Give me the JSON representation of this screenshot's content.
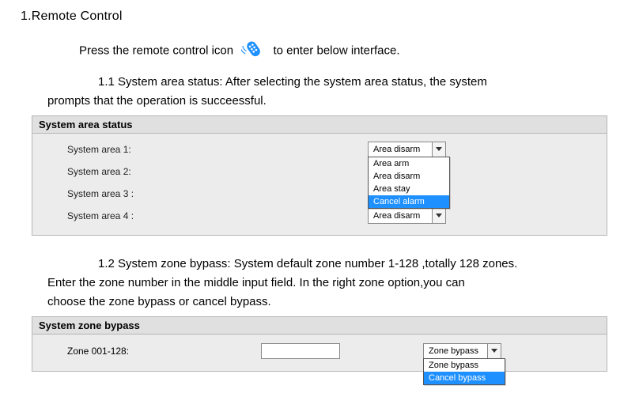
{
  "heading": "1.Remote Control",
  "intro_before": "Press the remote control icon",
  "intro_after": "to enter below interface.",
  "section11_lead": "1.1 System area status: After selecting the system area status, the system",
  "section11_cont": "prompts that the operation is succeessful.",
  "panel1": {
    "title": "System area status",
    "rows": [
      {
        "label": "System area 1:",
        "value": "Area disarm"
      },
      {
        "label": "System area 2:",
        "value": ""
      },
      {
        "label": "System area 3 :",
        "value": ""
      },
      {
        "label": "System area 4 :",
        "value": "Area disarm"
      }
    ],
    "dropdown_options": [
      "Area arm",
      "Area disarm",
      "Area stay",
      "Cancel alarm"
    ]
  },
  "section12_lead": "1.2 System zone bypass: System default zone number 1-128 ,totally 128 zones.",
  "section12_l2": "Enter the zone number in the middle input field. In the right zone option,you can",
  "section12_l3": "choose the zone bypass or cancel bypass.",
  "panel2": {
    "title": "System zone bypass",
    "row": {
      "label": "Zone 001-128:",
      "value": "Zone bypass",
      "input": ""
    },
    "dropdown_options": [
      "Zone bypass",
      "Cancel bypass"
    ]
  }
}
